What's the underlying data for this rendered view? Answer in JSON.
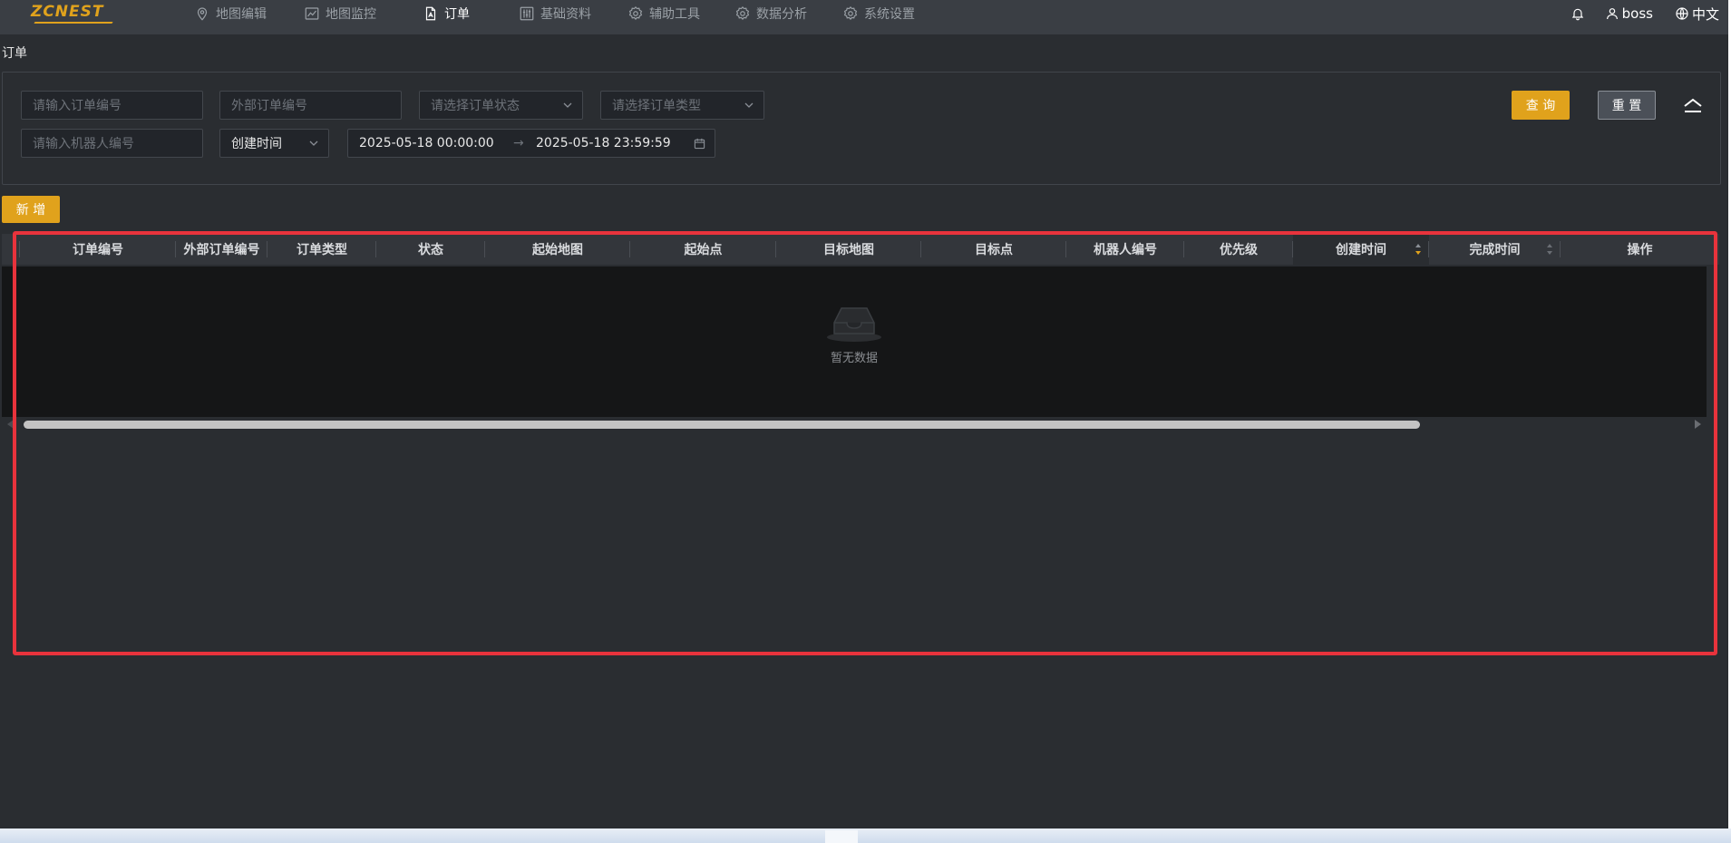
{
  "app": {
    "logo": "ZCNEST",
    "colors": {
      "accent": "#e0a21c",
      "highlight": "#e8333c",
      "background": "#2a2d31"
    }
  },
  "nav": {
    "items": [
      {
        "label": "地图编辑",
        "icon": "map-pin-icon"
      },
      {
        "label": "地图监控",
        "icon": "line-chart-icon"
      },
      {
        "label": "订单",
        "icon": "document-icon",
        "active": true
      },
      {
        "label": "基础资料",
        "icon": "sliders-icon"
      },
      {
        "label": "辅助工具",
        "icon": "gear-icon"
      },
      {
        "label": "数据分析",
        "icon": "gear-icon"
      },
      {
        "label": "系统设置",
        "icon": "gear-icon"
      }
    ],
    "user": "boss",
    "language": "中文"
  },
  "page": {
    "title": "订单"
  },
  "filters": {
    "order_no_placeholder": "请输入订单编号",
    "external_order_no_placeholder": "外部订单编号",
    "order_status_placeholder": "请选择订单状态",
    "order_type_placeholder": "请选择订单类型",
    "robot_no_placeholder": "请输入机器人编号",
    "time_field": "创建时间",
    "start_time": "2025-05-18 00:00:00",
    "range_separator": "→",
    "end_time": "2025-05-18 23:59:59",
    "query_label": "查 询",
    "reset_label": "重 置"
  },
  "toolbar": {
    "add_label": "新 增"
  },
  "table": {
    "columns": [
      "订单编号",
      "外部订单编号",
      "订单类型",
      "状态",
      "起始地图",
      "起始点",
      "目标地图",
      "目标点",
      "机器人编号",
      "优先级",
      "创建时间",
      "完成时间",
      "操作"
    ],
    "sorted_column": "创建时间",
    "empty_text": "暂无数据"
  }
}
